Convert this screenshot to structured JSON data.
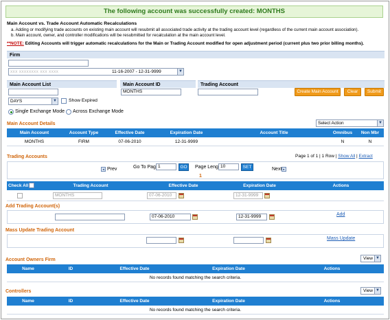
{
  "banner": "The following account was successfully created: MONTHS",
  "recalc": {
    "heading": "Main Account vs. Trade Account Automatic Recalculations",
    "line_a": "a. Adding or modifying trade accounts on existing main account will resubmit all associated trade activity at the trading account level (regardless of the current main account association).",
    "line_b": "b. Main account, owner, and controller modifications will be resubmitted for recalculation at the main account level.",
    "note_label": "**NOTE:",
    "note_text": " Editing Accounts will trigger automatic recalculations for the Main or Trading Account modified for open adjustment period (current plus two prior billing months)."
  },
  "firm": {
    "label": "Firm",
    "input_value": "",
    "select_value": "11-16-2007 - 12-31-9999",
    "select_prefix_redacted": "xxx  xxxxxxxx  xxx  xxxx"
  },
  "search": {
    "main_account_list_label": "Main Account List",
    "main_account_id_label": "Main Account ID",
    "trading_account_label": "Trading Account",
    "main_account_list_value": "",
    "main_account_id_value": "MONTHS",
    "trading_account_value": "",
    "days_value": "DAYS",
    "show_expired_label": "Show Expired",
    "create_button": "Create Main Account",
    "clear_button": "Clear",
    "submit_button": "Submit"
  },
  "mode": {
    "single": "Single Exchange Mode",
    "across": "Across Exchange Mode"
  },
  "main_details": {
    "title": "Main Account Details",
    "select_action": "Select Action",
    "headers": [
      "Main Account",
      "Account Type",
      "Effective Date",
      "Expiration Date",
      "Account Title",
      "Omnibus",
      "Non Mbr"
    ],
    "row": [
      "MONTHS",
      "FIRM",
      "07-06-2010",
      "12-31-9999",
      "",
      "N",
      "N"
    ]
  },
  "trading": {
    "title": "Trading Accounts",
    "page_info": "Page 1 of 1 | 1 Row  |",
    "show_all": "Show All",
    "sep": "|",
    "extract": "Extract",
    "prev": "Prev",
    "next": "Next",
    "goto_label": "Go To Page",
    "goto_value": "1",
    "go_button": "GO",
    "page_length_label": "Page Length",
    "page_length_value": "10",
    "set_button": "SET",
    "page_number": "1",
    "headers": [
      "Check All",
      "Trading Account",
      "Effective Date",
      "Expiration Date",
      "Actions"
    ],
    "row": {
      "trading_account": "MONTHS",
      "effective": "07-06-2010",
      "expiration": "12-31-9999"
    }
  },
  "add_trading": {
    "title": "Add Trading Account(s)",
    "effective": "07-06-2010",
    "expiration": "12-31-9999",
    "add_link": "Add"
  },
  "mass_update": {
    "title": "Mass Update Trading Account",
    "link": "Mass Update"
  },
  "owners": {
    "title": "Account Owners Firm",
    "view": "View",
    "headers": [
      "Name",
      "ID",
      "Effective Date",
      "Expiration Date",
      "Actions"
    ],
    "empty": "No records found matching the search criteria."
  },
  "controllers": {
    "title": "Controllers",
    "view": "View",
    "headers": [
      "Name",
      "ID",
      "Effective Date",
      "Expiration Date",
      "Actions"
    ],
    "empty": "No records found matching the search criteria."
  },
  "colors": {
    "accent_blue": "#1f7fd1",
    "section_orange": "#d0650a",
    "button_orange": "#f09a1a",
    "success_green": "#2d7a1b"
  }
}
